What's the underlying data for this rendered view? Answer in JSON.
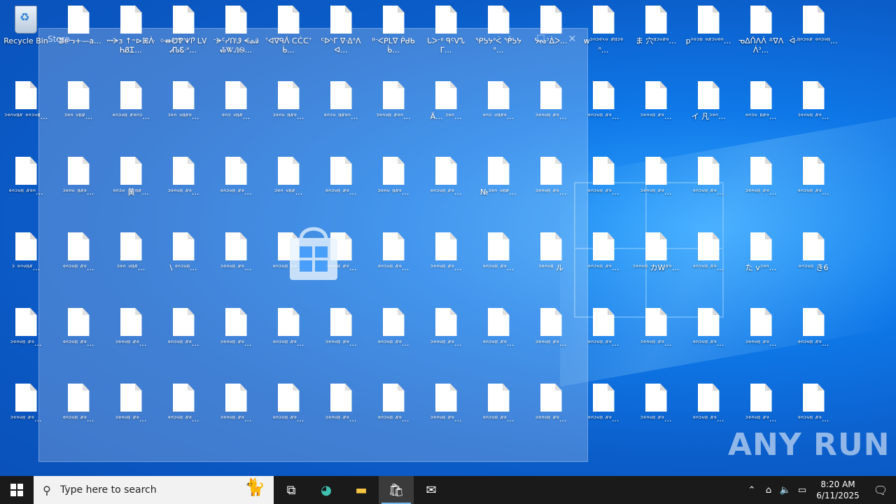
{
  "desktop": {
    "recycle_bin_label": "Recycle Bin",
    "file_labels": [
      "ᐟᕲᥱᓓ+—a...",
      "ꟷᗒɜ ↑⁼⊳ꕤᐿᏂᏰᏆ...",
      "ᛜᚒᏬᏈᗐᎵ ᏞᏙᏗᏖᏋᐧᐡ...",
      "ᐨᗓᑦᓯᑨᏭ ᗕᏸᎯᏱᏔᏁᏫ...",
      "ᐪᐊᐁᑫᐰ ᑕᑖᑕᐪᑳ...",
      "ᑦᐅᔅᒥ ᐁᐧᐃᐤᐱᐊ...",
      "ᐦᐨᐸᑭᒪᐁ ᑮᑯᑲᑳ...",
      "ᒐᐳᐨᐦ ᑫᑦᐯᔐᒥ...",
      "ᕿᕊᔭᐤᐹ ᖀᕊᔭᐤ...",
      "ᔭᔓᐣᐄᐳ...",
      "wᐣᐢᐣᐤᐠᐡ ᐥᐦᐣᐤᐢ...",
      "ま 穴ᐦᐣᐡᐥᐤ...",
      "pᐢᐤᐣᐦ ᐤᐥᐣᐡᐤᐢ...",
      "ᓀᐃᑍᐱᐲ ᐞᐁᐱᐲᐣ...",
      "ᐚᐦᐢᐣᐤᐥ ᐤᐢᐣᐡᐦ...",
      "ᐚᐤᐣᐢ ま ᐥᐤᐣᐡᐦ...",
      "ᐣᐤᐢᐡᐦᐥ ᐤᐢᐣᐡᐦ...",
      "ᐣᐤᐢ ᐡᐦᐥ...",
      "ᐤᐢᐣᐡᐦ ᐥᐤᐢᐣ...",
      "ᐣᐤᐢ ᐡᐦᐥᐤ...",
      "ᐤᐢᐣ ᐡᐦᐥ...",
      "ᐣᐤᐢᐡ ᐦᐥᐤ...",
      "ᐤᐢᐣᐡ ᐦᐥᐤᐢ...",
      "ᐣᐤᐢᐡᐦ ᐥᐤᐢ...",
      "Ä... ᐣᐤᐢ...",
      "ᐤᐢᐣ ᐡᐦᐥᐤ...",
      "ᐣᐤᐢᐡᐦ ᐥᐤ...",
      "ᐤᐢᐣᐡᐦ ᐥᐤ...",
      "ᐣᐤᐢᐡᐦ ᐥᐤ...",
      "イ 凡ᐣᐤᐢ...",
      "ᐤᐢᐣᐡ ᐦᐥᐤ...",
      "ᐣᐤᐢᐡᐦ ᐥᐤ...",
      "ᐤᐢᐣᐡᐦ ᐥᐤᐢ...",
      "ᐣᐤᐢᐡ ᐦᐥᐤ...",
      "ᐤᐢᐣᐡ 黄ᐦᐥ...",
      "ᐣᐤᐢᐡᐦ ᐥᐤ...",
      "ᐤᐢᐣᐡᐦ ᐥᐤ...",
      "ᐣᐤᐢ ᐡᐦᐥ...",
      "ᐤᐢᐣᐡᐦ ᐥᐤ...",
      "ᐣᐤᐢᐡ ᐦᐥᐤ...",
      "ᐤᐢᐣᐡᐦ ᐥᐤ...",
      "№ᐣᐤᐢ ᐡᐦᐥ...",
      "ᐣᐤᐢᐡᐦ ᐥᐤ...",
      "ᐤᐢᐣᐡᐦ ᐥᐤ...",
      "ᐣᐤᐢᐡᐦ ᐥᐤ...",
      "ᐤᐢᐣᐡᐦ ᐥᐤ...",
      "ᐣᐤᐢᐡᐦ ᐥᐤ...",
      "ᐤᐢᐣᐡᐦ ᐥᐤ...",
      "ᐣ ᐤᐢᐡᐦᐥ...",
      "ᐤᐢᐣᐡᐦ ᐥᐤ...",
      "ᐣᐤᐢ ᐡᐦᐥ...",
      "\\ ᐤᐢᐣᐡᐦ...",
      "ᐣᐤᐢᐡᐦ ᐥᐤ...",
      "ᐤᐢᐣᐡᐦ ᐥᐤ...",
      "ᐣᐤᐢᐡᐦ ᐥᐤ...",
      "ᐤᐢᐣᐡᐦ ᐥᐤ...",
      "ᐣᐤᐢᐡᐦ ᐥᐤ...",
      "ᐤᐢᐣᐡᐦ ᐥᐤ...",
      "ᐣᐤᐢᐡᐦ ル",
      "ᐤᐢᐣᐡᐦ ᐥᐤ...",
      "ᐣᐤᐢᐡᐦ カWᐥᐤ...",
      "ᐤᐢᐣᐡᐦ ᐥᐤ...",
      "た vᐣᐤᐢ...",
      "ᐤᐢᐣᐡᐦ き6",
      "ᐣᐤᐢᐡᐦ ᐥᐤ...",
      "ᐤᐢᐣᐡᐦ ᐥᐤ...",
      "ᐣᐤᐢᐡᐦ ᐥᐤ...",
      "ᐤᐢᐣᐡᐦ ᐥᐤ...",
      "ᐣᐤᐢᐡᐦ ᐥᐤ...",
      "ᐤᐢᐣᐡᐦ ᐥᐤ...",
      "ᐣᐤᐢᐡᐦ ᐥᐤ...",
      "ᐤᐢᐣᐡᐦ ᐥᐤ...",
      "ᐣᐤᐢᐡᐦ ᐥᐤ...",
      "ᐤᐢᐣᐡᐦ ᐥᐤ...",
      "ᐣᐤᐢᐡᐦ ᐥᐤ...",
      "ᐤᐢᐣᐡᐦ ᐥᐤ...",
      "ᐣᐤᐢᐡᐦ ᐥᐤ...",
      "ᐤᐢᐣᐡᐦ ᐥᐤ...",
      "ᐣᐤᐢᐡᐦ ᐥᐤ...",
      "ᐤᐢᐣᐡᐦ ᐥᐤ...",
      "ᐣᐤᐢᐡᐦ ᐥᐤ...",
      "ᐤᐢᐣᐡᐦ ᐥᐤ...",
      "ᐣᐤᐢᐡᐦ ᐥᐤ...",
      "ᐤᐢᐣᐡᐦ ᐥᐤ...",
      "ᐣᐤᐢᐡᐦ ᐥᐤ...",
      "ᐤᐢᐣᐡᐦ ᐥᐤ...",
      "ᐣᐤᐢᐡᐦ ᐥᐤ...",
      "ᐤᐢᐣᐡᐦ ᐥᐤ...",
      "ᐣᐤᐢᐡᐦ ᐥᐤ...",
      "ᐤᐢᐣᐡᐦ ᐥᐤ...",
      "ᐣᐤᐢᐡᐦ ᐥᐤ...",
      "ᐤᐢᐣᐡᐦ ᐥᐤ...",
      "ᐣᐤᐢᐡᐦ ᐥᐤ...",
      "ᐤᐢᐣᐡᐦ ᐥᐤ...",
      "ᐣᐤᐢᐡᐦ ᐥᐤ...",
      "ᐤᐢᐣᐡᐦ ᐥᐤ..."
    ]
  },
  "store_window": {
    "title": "Store"
  },
  "taskbar": {
    "search_placeholder": "Type here to search",
    "time": "8:20 AM",
    "date": "6/11/2025"
  },
  "watermark": "ANY RUN"
}
